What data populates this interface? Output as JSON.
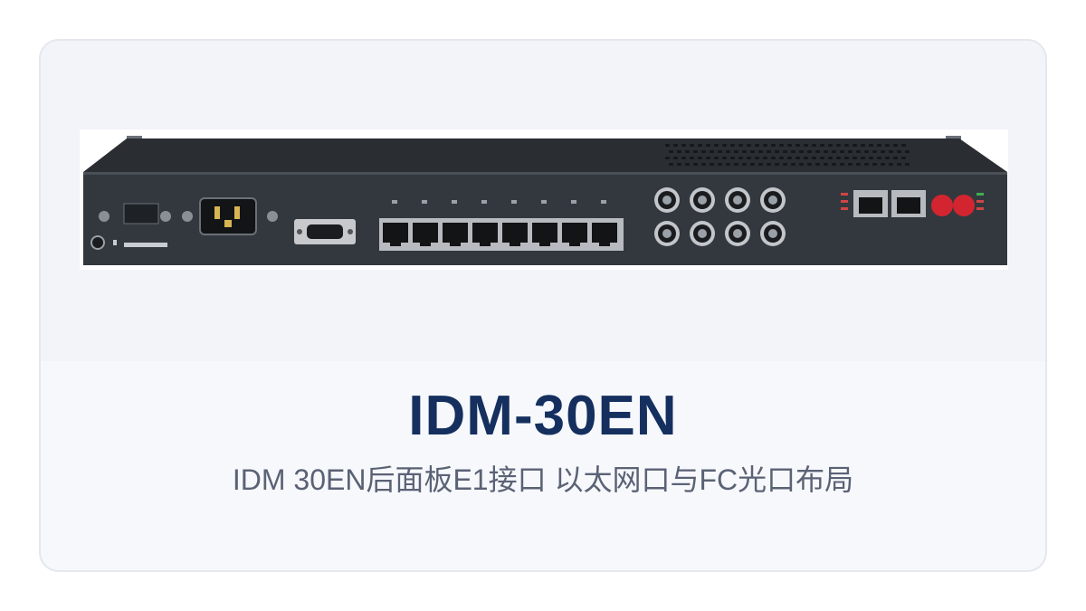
{
  "product": {
    "name": "IDM-30EN",
    "caption": "IDM 30EN后面板E1接口 以太网口与FC光口布局"
  },
  "colors": {
    "title": "#15305f",
    "caption": "#5a6275",
    "card_border": "#e4e7ee",
    "card_background": "#f7f8fc",
    "image_background": "#f2f4f9",
    "chassis": "#2d3136"
  },
  "photo": {
    "subject": "rear-panel",
    "ethernet_port_count": 8,
    "bnc_connector_count": 8,
    "sfp_port_count": 2,
    "fc_optical_port_count": 2
  }
}
